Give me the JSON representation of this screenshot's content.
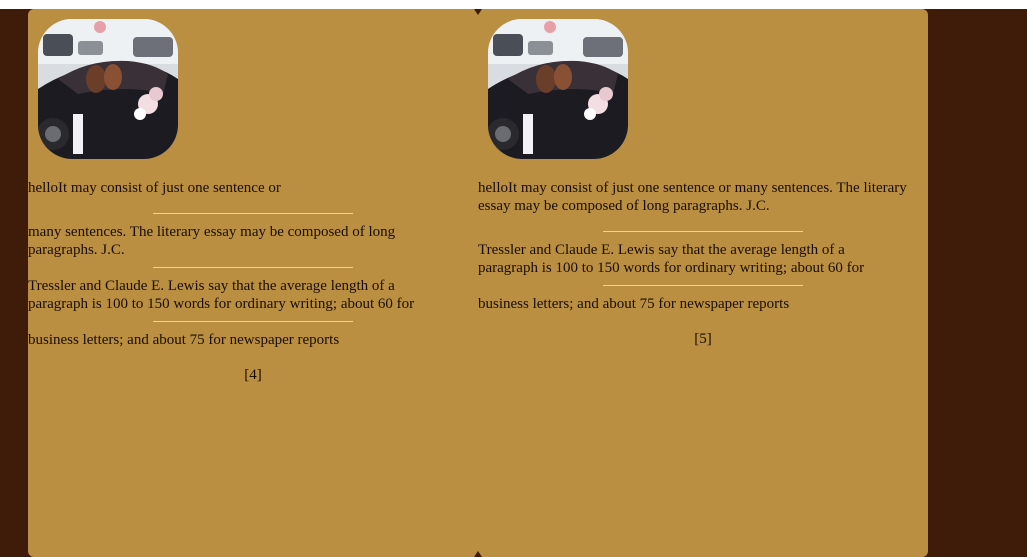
{
  "left_page": {
    "paragraphs": [
      "helloIt may consist of just one sentence or",
      "many sentences. The literary essay may be composed of long paragraphs. J.C.",
      "Tressler and Claude E. Lewis say that the average length of a paragraph is 100 to 150 words for ordinary writing; about 60 for",
      "business letters; and about 75 for newspaper reports"
    ],
    "page_number": "[4]"
  },
  "right_page": {
    "paragraphs": [
      "helloIt may consist of just one sentence or many sentences. The literary essay may be composed of long paragraphs. J.C.",
      "Tressler and Claude E. Lewis say that the average length of a paragraph is 100 to 150 words for ordinary writing; about 60 for",
      "business letters; and about 75 for newspaper reports"
    ],
    "page_number": "[5]"
  },
  "colors": {
    "page": "#bb8f42",
    "background": "#3f1b0a",
    "rule": "#e6d3ad"
  },
  "icons": {
    "photo": "wedding-car-photo"
  }
}
